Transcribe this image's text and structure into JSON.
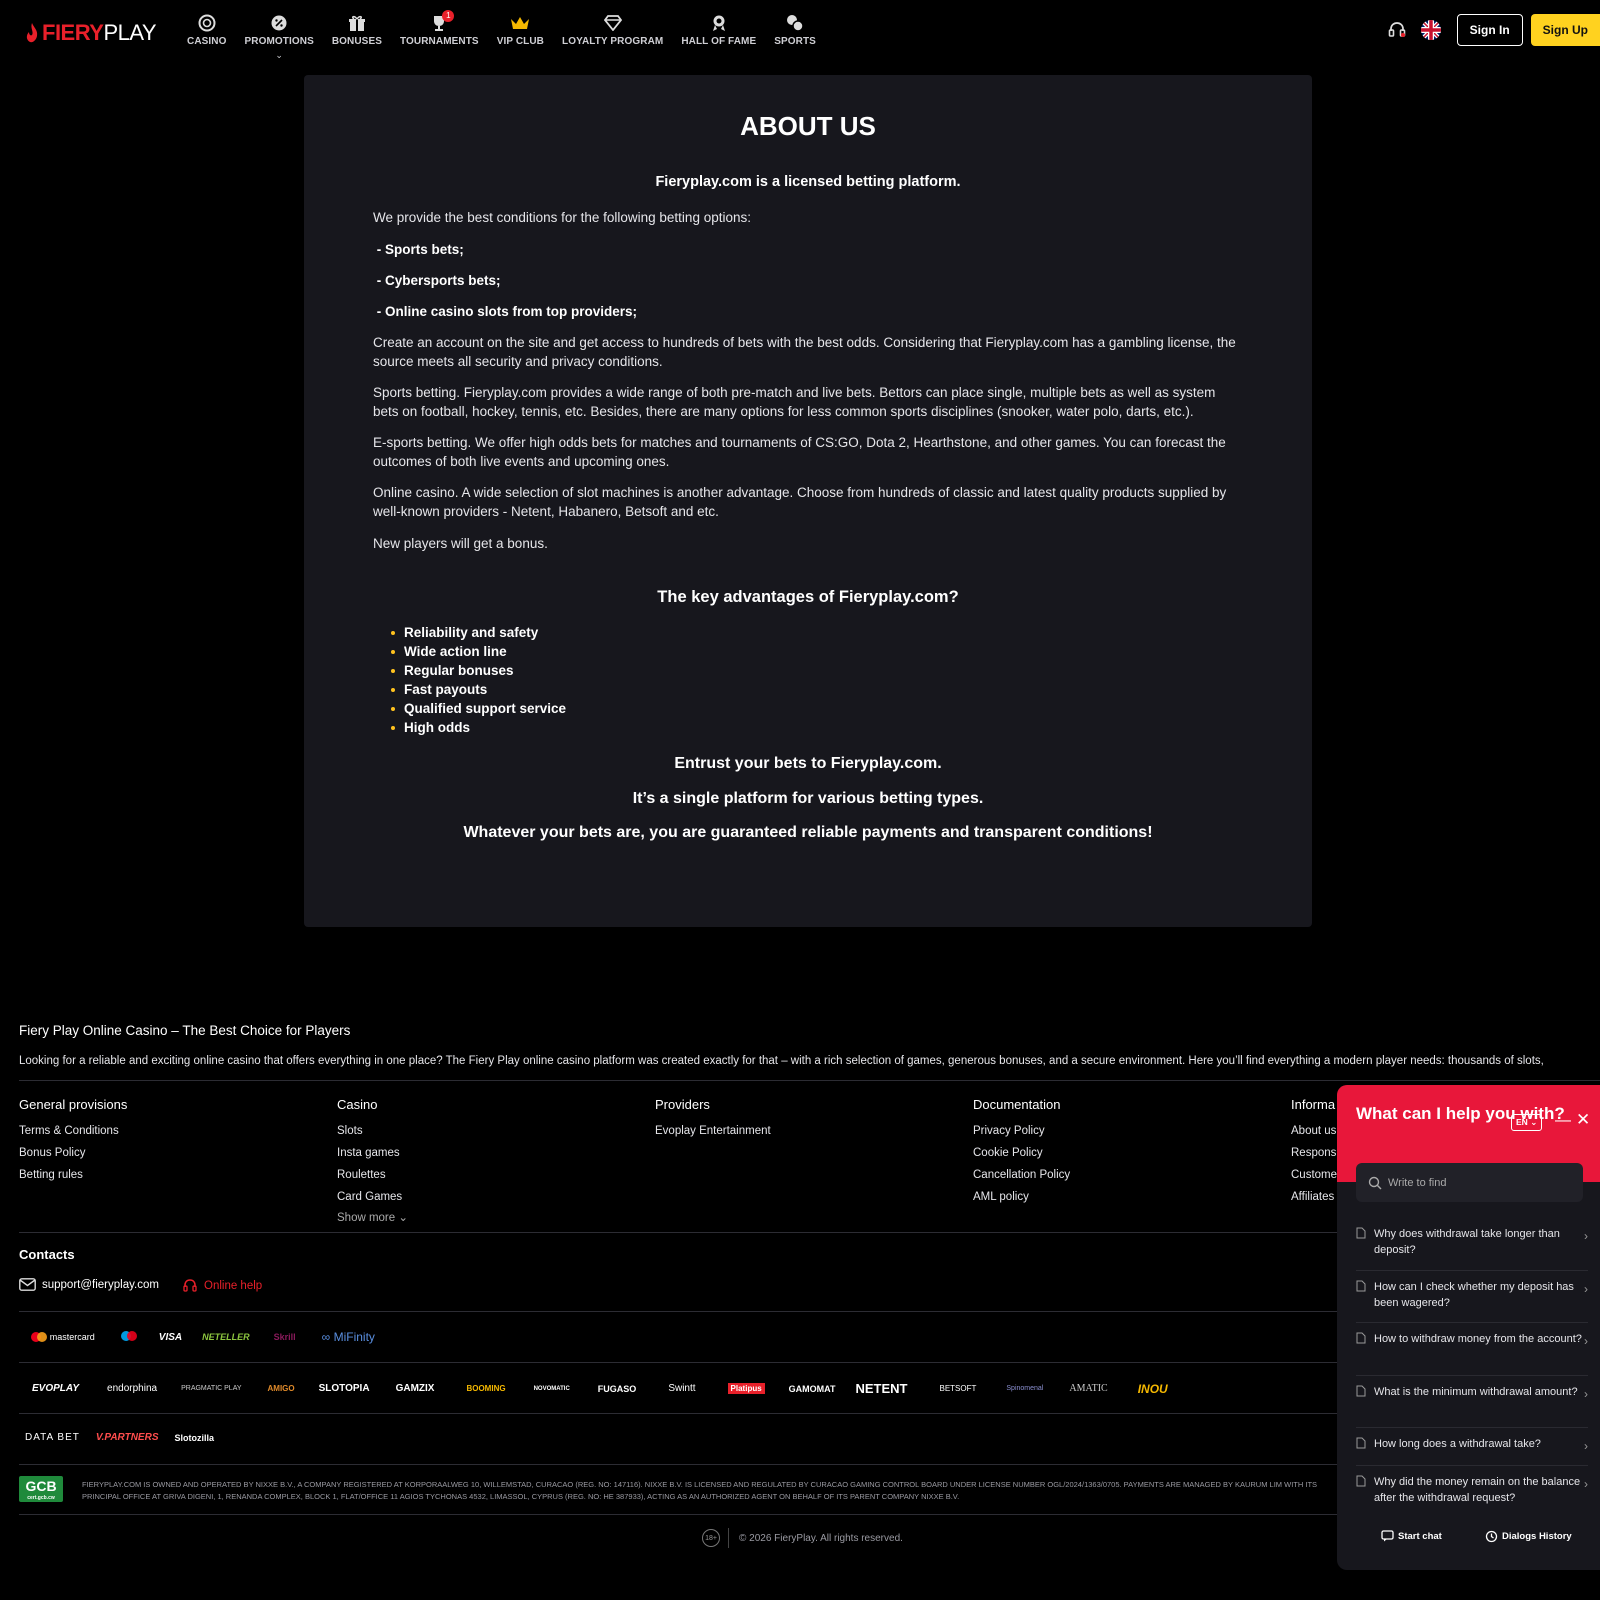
{
  "header": {
    "logo": {
      "fiery": "FIERY",
      "play": "PLAY"
    },
    "nav": [
      {
        "label": "CASINO",
        "icon": "casino-chip-icon"
      },
      {
        "label": "PROMOTIONS",
        "icon": "promotions-icon",
        "has_dropdown": true
      },
      {
        "label": "BONUSES",
        "icon": "gift-icon"
      },
      {
        "label": "TOURNAMENTS",
        "icon": "trophy-icon",
        "badge": "1"
      },
      {
        "label": "VIP CLUB",
        "icon": "crown-icon"
      },
      {
        "label": "LOYALTY PROGRAM",
        "icon": "diamond-icon"
      },
      {
        "label": "HALL OF FAME",
        "icon": "award-icon"
      },
      {
        "label": "SPORTS",
        "icon": "sports-icon"
      }
    ],
    "sign_in": "Sign In",
    "sign_up": "Sign Up"
  },
  "about": {
    "title": "ABOUT US",
    "subtitle": "Fieryplay.com is a licensed betting platform.",
    "intro": "We provide the best conditions for the following betting options:",
    "options": [
      " - Sports bets;",
      " - Cybersports bets;",
      " - Online casino slots from top providers;"
    ],
    "paragraphs": [
      "Create an account on the site and get access to hundreds of bets with the best odds. Considering that Fieryplay.com has a gambling license, the source meets all security and privacy conditions.",
      "Sports betting. Fieryplay.com provides a wide range of both pre-match and live bets. Bettors can place single, multiple bets as well as system bets on football, hockey, tennis, etc. Besides, there are many options for less common sports disciplines (snooker, water polo, darts, etc.).",
      "E-sports betting. We offer high odds bets for matches and tournaments of CS:GO, Dota 2, Hearthstone, and other games. You can forecast the outcomes of both live events and upcoming ones.",
      "Online casino. A wide selection of slot machines is another advantage. Choose from hundreds of classic and latest quality products supplied by well-known providers - Netent, Habanero, Betsoft and etc.",
      "New players will get a bonus."
    ],
    "advantages_title": "The key advantages of Fieryplay.com?",
    "advantages": [
      "Reliability and safety",
      "Wide action line",
      "Regular bonuses",
      "Fast payouts",
      "Qualified support service",
      "High odds"
    ],
    "closing": [
      "Entrust your bets to Fieryplay.com.",
      "It’s a single platform for various betting types.",
      "Whatever your bets are, you are guaranteed reliable payments and transparent conditions!"
    ]
  },
  "footer": {
    "title": "Fiery Play Online Casino – The Best Choice for Players",
    "intro": "Looking for a reliable and exciting online casino that offers everything in one place? The Fiery Play online casino platform was created exactly for that – with a rich selection of games, generous bonuses, and a secure environment. Here you’ll find everything a modern player needs: thousands of slots,",
    "columns": [
      {
        "title": "General provisions",
        "links": [
          "Terms & Conditions",
          "Bonus Policy",
          "Betting rules"
        ]
      },
      {
        "title": "Casino",
        "links": [
          "Slots",
          "Insta games",
          "Roulettes",
          "Card Games"
        ],
        "show_more": "Show more"
      },
      {
        "title": "Providers",
        "links": [
          "Evoplay Entertainment"
        ]
      },
      {
        "title": "Documentation",
        "links": [
          "Privacy Policy",
          "Cookie Policy",
          "Cancellation Policy",
          "AML policy"
        ]
      },
      {
        "title": "Informa",
        "links": [
          "About us",
          "Respons",
          "Custome",
          "Affiliates"
        ]
      }
    ],
    "contacts_title": "Contacts",
    "email": "support@fieryplay.com",
    "online_help": "Online help",
    "payments": [
      "mastercard",
      "VISA",
      "NETELLER",
      "Skrill",
      "MiFinity"
    ],
    "providers": [
      "EVOPLAY",
      "endorphina",
      "PRAGMATIC PLAY",
      "AMIGO",
      "SLOTOPIA",
      "GAMZIX",
      "BOOMING",
      "NOVOMATIC",
      "FUGASO",
      "Swintt",
      "Platipus",
      "GAMOMAT",
      "NETENT",
      "BETSOFT",
      "Spinomenal",
      "AMATIC",
      "INOU"
    ],
    "partners": [
      "DATA BET",
      "V.PARTNERS",
      "Slotozilla"
    ],
    "gcb": {
      "main": "GCB",
      "sub": "cert.gcb.cw"
    },
    "legal": "FIERYPLAY.COM IS OWNED AND OPERATED BY NIXXE B.V., A COMPANY REGISTERED AT KORPORAALWEG 10, WILLEMSTAD, CURACAO (REG. NO: 147116). NIXXE B.V. IS LICENSED AND REGULATED BY CURACAO GAMING CONTROL BOARD UNDER LICENSE NUMBER OGL/2024/1363/0705. PAYMENTS ARE MANAGED BY KAURUM LIM WITH ITS PRINCIPAL OFFICE AT GRIVA DIGENI, 1, RENANDA COMPLEX, BLOCK 1, FLAT/OFFICE 11 AGIOS TYCHONAS 4532, LIMASSOL, CYPRUS (REG. NO: HE 387933), ACTING AS AN AUTHORIZED AGENT ON BEHALF OF ITS PARENT COMPANY NIXXE B.V.",
    "age": "18+",
    "copyright": "© 2026 FieryPlay. All rights reserved."
  },
  "help_widget": {
    "title": "What can I help you with?",
    "lang": "EN",
    "search_placeholder": "Write to find",
    "faq": [
      "Why does withdrawal take longer than deposit?",
      "How can I check whether my deposit has been wagered?",
      "How to withdraw money from the account?",
      "What is the minimum withdrawal amount?",
      "How long does a withdrawal take?",
      "Why did the money remain on the balance after the withdrawal request?"
    ],
    "start_chat": "Start chat",
    "dialogs_history": "Dialogs History"
  },
  "colors": {
    "brand_red": "#e8202a",
    "accent_yellow": "#ffd21f",
    "card_bg": "#17171d",
    "widget_red": "#e8173a"
  }
}
